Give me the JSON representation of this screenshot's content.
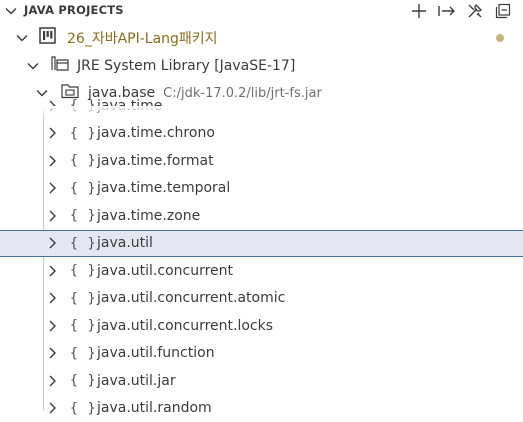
{
  "header": {
    "title": "JAVA PROJECTS"
  },
  "project": {
    "name": "26_자바API-Lang패키지"
  },
  "library": {
    "name": "JRE System Library [JavaSE-17]"
  },
  "module": {
    "name": "java.base",
    "path": "C:/jdk-17.0.2/lib/jrt-fs.jar"
  },
  "package_icon": "{ }",
  "packages": [
    {
      "name": "java.time"
    },
    {
      "name": "java.time.chrono"
    },
    {
      "name": "java.time.format"
    },
    {
      "name": "java.time.temporal"
    },
    {
      "name": "java.time.zone"
    },
    {
      "name": "java.util",
      "selected": true
    },
    {
      "name": "java.util.concurrent"
    },
    {
      "name": "java.util.concurrent.atomic"
    },
    {
      "name": "java.util.concurrent.locks"
    },
    {
      "name": "java.util.function"
    },
    {
      "name": "java.util.jar"
    },
    {
      "name": "java.util.random"
    }
  ],
  "icons": {
    "header_actions": [
      "plus-icon",
      "export-arrow-icon",
      "tools-icon",
      "collapse-all-icon"
    ],
    "project": "project-board-icon",
    "library": "library-icon",
    "module": "package-folder-icon"
  },
  "colors": {
    "selection_bg": "#e4e6f1",
    "selection_border": "#4a6fa5",
    "modified_dot": "#c9b27c"
  }
}
